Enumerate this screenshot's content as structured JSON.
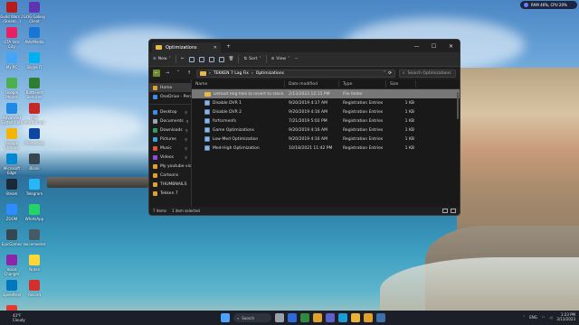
{
  "desktop_icons": [
    {
      "label": "Guild Wars 2 (Steam...)",
      "color": "#b71c1c"
    },
    {
      "label": "GOG Galaxy Client",
      "color": "#5e35b1"
    },
    {
      "label": "GTA Vice City",
      "color": "#e91e63"
    },
    {
      "label": "AVerMedia",
      "color": "#1976d2"
    },
    {
      "label": "My PC",
      "color": "#42a5f5"
    },
    {
      "label": "Skype IT",
      "color": "#00aff0"
    },
    {
      "label": "Google Photos",
      "color": "#4caf50"
    },
    {
      "label": "Battlenet Services",
      "color": "#2e7d32"
    },
    {
      "label": "Advanced SystemCare",
      "color": "#1e88e5"
    },
    {
      "label": "MSI Afterburner",
      "color": "#c62828"
    },
    {
      "label": "Google Chrome",
      "color": "#f4b400"
    },
    {
      "label": "Photoshop",
      "color": "#0d47a1"
    },
    {
      "label": "Microsoft Edge",
      "color": "#0288d1"
    },
    {
      "label": "Blank",
      "color": "#37474f"
    },
    {
      "label": "Steam",
      "color": "#1b2838"
    },
    {
      "label": "Telegram",
      "color": "#29b6f6"
    },
    {
      "label": "ZOOM",
      "color": "#2d8cff"
    },
    {
      "label": "WhatsApp",
      "color": "#25d366"
    },
    {
      "label": "EpicGames",
      "color": "#37474f"
    },
    {
      "label": "Voicemeeter",
      "color": "#455a64"
    },
    {
      "label": "Voice Changer",
      "color": "#8e24aa"
    },
    {
      "label": "Notes",
      "color": "#fdd835"
    },
    {
      "label": "Speedtest",
      "color": "#0277bd"
    },
    {
      "label": "Record",
      "color": "#d32f2f"
    },
    {
      "label": "Adobe Reader",
      "color": "#e53935"
    }
  ],
  "perf_badge": "RAM 46%, CPU 20%",
  "window": {
    "tab_title": "Optimizations",
    "toolbar": {
      "new": "New",
      "sort": "Sort",
      "view": "View",
      "more": "···"
    },
    "breadcrumb": [
      "TEKKEN 7 Lag Fix",
      "Optimizations"
    ],
    "search_placeholder": "Search Optimizations",
    "nav_items": [
      {
        "label": "Home",
        "icon_color": "#e0a030",
        "selected": true
      },
      {
        "label": "OneDrive - Pers",
        "icon_color": "#3b8ee5"
      },
      {
        "sep": true
      },
      {
        "label": "Desktop",
        "icon_color": "#3b8ee5",
        "pin": true
      },
      {
        "label": "Documents",
        "icon_color": "#9aa6b8",
        "pin": true
      },
      {
        "label": "Downloads",
        "icon_color": "#2f9e5b",
        "pin": true
      },
      {
        "label": "Pictures",
        "icon_color": "#3aa0e0",
        "pin": true
      },
      {
        "label": "Music",
        "icon_color": "#e0562f",
        "pin": true
      },
      {
        "label": "Videos",
        "icon_color": "#8a4de0",
        "pin": true
      },
      {
        "label": "My youtube vio",
        "icon_color": "#e0a030"
      },
      {
        "label": "Cartoons",
        "icon_color": "#e0a030"
      },
      {
        "label": "THUMBNAILS",
        "icon_color": "#e0a030"
      },
      {
        "label": "Tekken 7",
        "icon_color": "#e0a030"
      }
    ],
    "columns": [
      "Name",
      "Date modified",
      "Type",
      "Size"
    ],
    "files": [
      {
        "name": "Default Reg files to revert to stock if wanted",
        "date": "2/13/2023 12:15 PM",
        "type": "File folder",
        "size": "",
        "folder": true,
        "selected": true
      },
      {
        "name": "Disable DVR 1",
        "date": "9/20/2019 4:17 AM",
        "type": "Registration Entries",
        "size": "1 KB"
      },
      {
        "name": "Disable DVR 2",
        "date": "9/20/2019 4:16 AM",
        "type": "Registration Entries",
        "size": "1 KB"
      },
      {
        "name": "fsrfscmenfs",
        "date": "7/21/2019 5:02 PM",
        "type": "Registration Entries",
        "size": "1 KB"
      },
      {
        "name": "Game Optimizations",
        "date": "9/20/2019 4:16 AM",
        "type": "Registration Entries",
        "size": "1 KB"
      },
      {
        "name": "Low-Med Optimization",
        "date": "9/20/2019 4:16 AM",
        "type": "Registration Entries",
        "size": "1 KB"
      },
      {
        "name": "Med-High Optimization",
        "date": "10/18/2021 11:42 PM",
        "type": "Registration Entries",
        "size": "1 KB"
      }
    ],
    "status_items": "7 items",
    "status_selected": "1 item selected"
  },
  "taskbar": {
    "weather_temp": "43°F",
    "weather_desc": "Cloudy",
    "search_label": "Search",
    "lang": "ENG",
    "time": "1:23 PM",
    "date": "2/13/2023",
    "apps": [
      {
        "name": "start-icon",
        "color": "#4aa3ff"
      },
      {
        "name": "task-view-icon",
        "color": "#9aa0aa"
      },
      {
        "name": "widgets-icon",
        "color": "#2f6bd8"
      },
      {
        "name": "xbox-icon",
        "color": "#2e8b3e"
      },
      {
        "name": "app-icon",
        "color": "#e0a030"
      },
      {
        "name": "teams-icon",
        "color": "#5b5fc7"
      },
      {
        "name": "edge-icon",
        "color": "#1d9bd7"
      },
      {
        "name": "chrome-icon",
        "color": "#e8b43a"
      },
      {
        "name": "explorer-icon",
        "color": "#e0a030"
      },
      {
        "name": "steam-icon",
        "color": "#3d6fa8"
      }
    ]
  }
}
